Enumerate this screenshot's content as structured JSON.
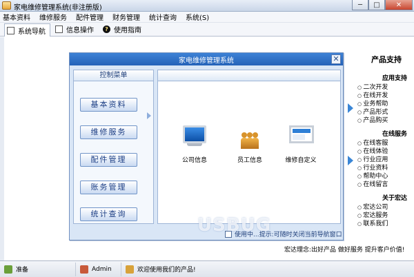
{
  "window": {
    "title": "家电维修管理系统(非注册版)",
    "min_label": "─",
    "max_label": "□",
    "close_label": "✕"
  },
  "menu": [
    "基本资料",
    "维修服务",
    "配件管理",
    "财务管理",
    "统计查询",
    "系统(S)"
  ],
  "tabs": [
    {
      "label": "系统导航",
      "icon": "window-icon",
      "active": true
    },
    {
      "label": "信息操作",
      "icon": "window-icon",
      "active": false
    },
    {
      "label": "使用指南",
      "icon": "help-icon",
      "active": false
    }
  ],
  "right_panel": {
    "title": "产品支持",
    "groups": [
      {
        "title": "应用支持",
        "links": [
          "二次开发",
          "在线开发",
          "业务帮助",
          "产品形式",
          "产品购买"
        ]
      },
      {
        "title": "在线服务",
        "links": [
          "在线客服",
          "在线体验",
          "行业应用",
          "行业资料",
          "帮助中心",
          "在线留言"
        ]
      },
      {
        "title": "关于宏达",
        "links": [
          "宏达公司",
          "宏达服务",
          "联系我们"
        ]
      }
    ],
    "slogan": "宏达理念:出好产品  做好服务  提升客户价值!"
  },
  "dialog": {
    "title": "家电维修管理系统",
    "close_label": "✕",
    "nav_title": "控制菜单",
    "nav_items": [
      "基本资料",
      "维修服务",
      "配件管理",
      "账务管理",
      "统计查询"
    ],
    "modules": [
      {
        "label": "公司信息",
        "icon": "monitor-icon"
      },
      {
        "label": "员工信息",
        "icon": "people-icon"
      },
      {
        "label": "维修自定义",
        "icon": "screen-edit-icon"
      }
    ],
    "footer": "使用中...提示:可随时关闭当前导航窗口"
  },
  "status": {
    "state": "准备",
    "user": "Admin",
    "welcome": "欢迎使用我们的产品!"
  },
  "watermark": "USBUG"
}
